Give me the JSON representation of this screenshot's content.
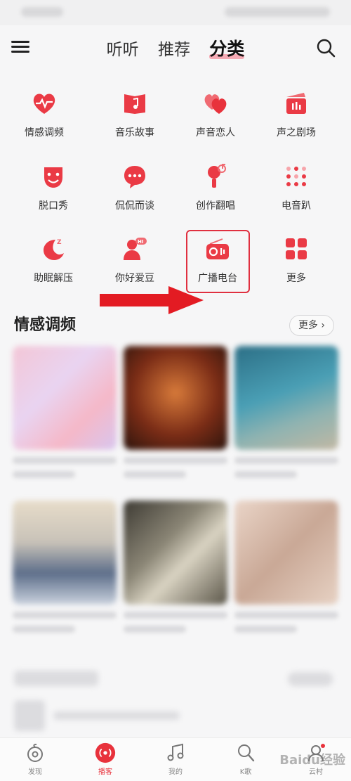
{
  "top_nav": {
    "tabs": [
      {
        "label": "听听"
      },
      {
        "label": "推荐"
      },
      {
        "label": "分类",
        "active": true
      }
    ]
  },
  "categories": [
    {
      "label": "情感调频",
      "icon": "heart-pulse-icon"
    },
    {
      "label": "音乐故事",
      "icon": "music-book-icon"
    },
    {
      "label": "声音恋人",
      "icon": "double-heart-icon"
    },
    {
      "label": "声之剧场",
      "icon": "clapperboard-icon"
    },
    {
      "label": "脱口秀",
      "icon": "mask-icon"
    },
    {
      "label": "侃侃而谈",
      "icon": "chat-bubble-icon"
    },
    {
      "label": "创作翻唱",
      "icon": "microphone-icon"
    },
    {
      "label": "电音趴",
      "icon": "dot-matrix-icon"
    },
    {
      "label": "助眠解压",
      "icon": "moon-icon"
    },
    {
      "label": "你好爱豆",
      "icon": "idol-hi-icon"
    },
    {
      "label": "广播电台",
      "icon": "radio-icon",
      "highlighted": true
    },
    {
      "label": "更多",
      "icon": "grid-icon"
    }
  ],
  "section": {
    "title": "情感调频",
    "more_label": "更多"
  },
  "bottom_nav": [
    {
      "label": "发现",
      "icon": "discover-icon"
    },
    {
      "label": "播客",
      "icon": "podcast-icon",
      "active": true
    },
    {
      "label": "我的",
      "icon": "music-note-icon"
    },
    {
      "label": "K歌",
      "icon": "karaoke-icon"
    },
    {
      "label": "云村",
      "icon": "community-icon"
    }
  ],
  "watermark": "Baidu经验",
  "colors": {
    "accent": "#e8323c",
    "highlight_border": "#e03040",
    "arrow": "#e31b23"
  }
}
